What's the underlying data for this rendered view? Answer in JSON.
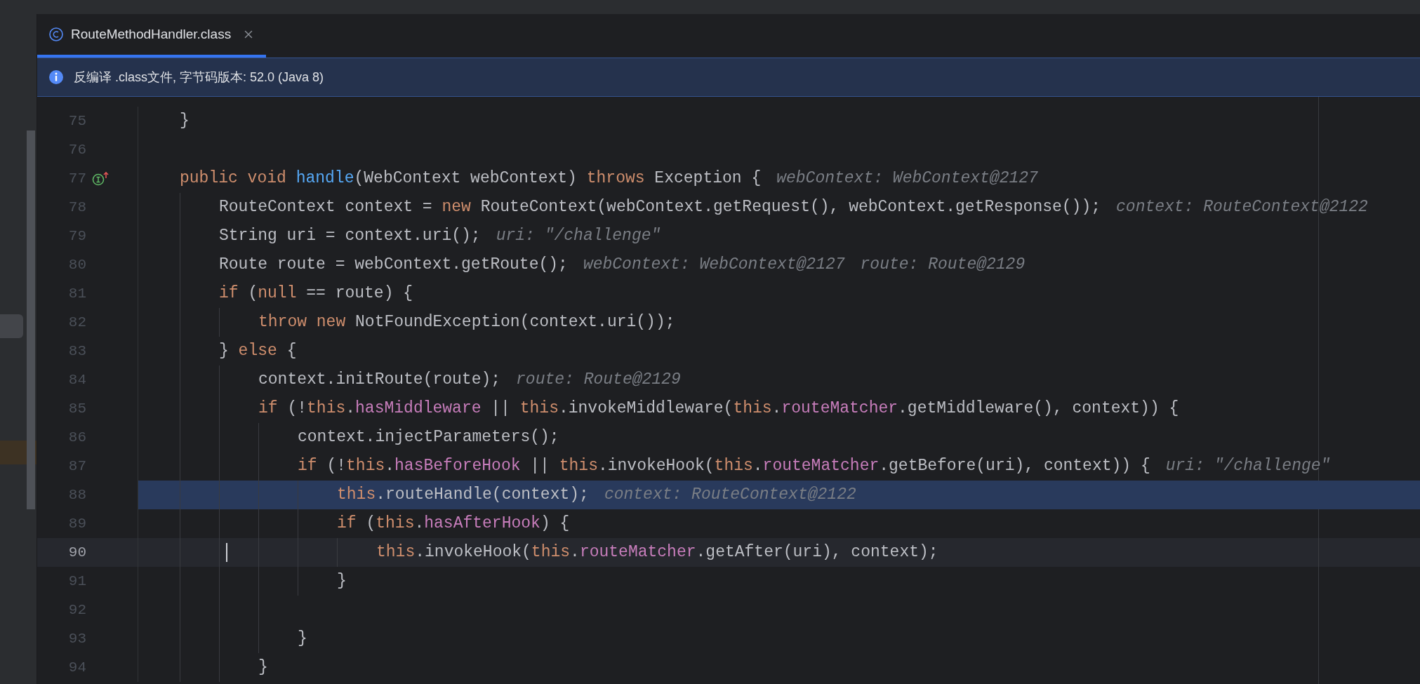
{
  "tab": {
    "title": "RouteMethodHandler.class",
    "selected": true
  },
  "banner": {
    "text": "反编译 .class文件, 字节码版本: 52.0 (Java 8)"
  },
  "lines": [
    {
      "children": [
        {
          "number": "75",
          "highlighted": false,
          "current": false,
          "gutter_marker": false,
          "tokens": [
            {
              "kind": "plain",
              "text": "}"
            }
          ]
        }
      ]
    },
    {
      "number": "76",
      "highlighted": false,
      "current": false,
      "gutter_marker": false
    },
    {
      "children": [
        {
          "number": "77",
          "highlighted": false,
          "current": false,
          "gutter_marker": true,
          "tokens": [
            {
              "kind": "keyword",
              "text": "public void "
            },
            {
              "kind": "method",
              "text": "handle"
            },
            {
              "kind": "plain",
              "text": "(WebContext webContext) "
            },
            {
              "kind": "keyword",
              "text": "throws"
            },
            {
              "kind": "plain",
              "text": " Exception {"
            },
            {
              "kind": "hint",
              "text": "webContext: WebContext@2127"
            }
          ]
        },
        {
          "children": [
            {
              "number": "78",
              "highlighted": false,
              "current": false,
              "gutter_marker": false,
              "tokens": [
                {
                  "kind": "plain",
                  "text": "RouteContext context = "
                },
                {
                  "kind": "keyword",
                  "text": "new"
                },
                {
                  "kind": "plain",
                  "text": " RouteContext(webContext.getRequest(), webContext.getResponse());"
                },
                {
                  "kind": "hint",
                  "text": "context: RouteContext@2122"
                }
              ]
            },
            {
              "number": "79",
              "highlighted": false,
              "current": false,
              "gutter_marker": false,
              "tokens": [
                {
                  "kind": "plain",
                  "text": "String uri = context.uri();"
                },
                {
                  "kind": "hint",
                  "text": "uri: \"/challenge\""
                }
              ]
            },
            {
              "number": "80",
              "highlighted": false,
              "current": false,
              "gutter_marker": false,
              "tokens": [
                {
                  "kind": "plain",
                  "text": "Route route = webContext.getRoute();"
                },
                {
                  "kind": "hint",
                  "text": "webContext: WebContext@2127"
                },
                {
                  "kind": "hint",
                  "text": "route: Route@2129"
                }
              ]
            },
            {
              "number": "81",
              "highlighted": false,
              "current": false,
              "gutter_marker": false,
              "tokens": [
                {
                  "kind": "keyword",
                  "text": "if"
                },
                {
                  "kind": "plain",
                  "text": " ("
                },
                {
                  "kind": "keyword",
                  "text": "null"
                },
                {
                  "kind": "plain",
                  "text": " == route) {"
                }
              ]
            },
            {
              "children": [
                {
                  "number": "82",
                  "highlighted": false,
                  "current": false,
                  "gutter_marker": false,
                  "tokens": [
                    {
                      "kind": "keyword",
                      "text": "throw new"
                    },
                    {
                      "kind": "plain",
                      "text": " NotFoundException(context.uri());"
                    }
                  ]
                }
              ]
            },
            {
              "number": "83",
              "highlighted": false,
              "current": false,
              "gutter_marker": false,
              "tokens": [
                {
                  "kind": "plain",
                  "text": "} "
                },
                {
                  "kind": "keyword",
                  "text": "else"
                },
                {
                  "kind": "plain",
                  "text": " {"
                }
              ]
            },
            {
              "children": [
                {
                  "number": "84",
                  "highlighted": false,
                  "current": false,
                  "gutter_marker": false,
                  "tokens": [
                    {
                      "kind": "plain",
                      "text": "context.initRoute(route);"
                    },
                    {
                      "kind": "hint",
                      "text": "route: Route@2129"
                    }
                  ]
                },
                {
                  "number": "85",
                  "highlighted": false,
                  "current": false,
                  "gutter_marker": false,
                  "tokens": [
                    {
                      "kind": "keyword",
                      "text": "if"
                    },
                    {
                      "kind": "plain",
                      "text": " (!"
                    },
                    {
                      "kind": "keyword",
                      "text": "this"
                    },
                    {
                      "kind": "field",
                      "text": ".hasMiddleware"
                    },
                    {
                      "kind": "plain",
                      "text": " || "
                    },
                    {
                      "kind": "keyword",
                      "text": "this"
                    },
                    {
                      "kind": "plain",
                      "text": ".invokeMiddleware("
                    },
                    {
                      "kind": "keyword",
                      "text": "this"
                    },
                    {
                      "kind": "field",
                      "text": ".routeMatcher"
                    },
                    {
                      "kind": "plain",
                      "text": ".getMiddleware(), context)) {"
                    }
                  ]
                },
                {
                  "children": [
                    {
                      "number": "86",
                      "highlighted": false,
                      "current": false,
                      "gutter_marker": false,
                      "tokens": [
                        {
                          "kind": "plain",
                          "text": "context.injectParameters();"
                        }
                      ]
                    },
                    {
                      "number": "87",
                      "highlighted": false,
                      "current": false,
                      "gutter_marker": false,
                      "tokens": [
                        {
                          "kind": "keyword",
                          "text": "if"
                        },
                        {
                          "kind": "plain",
                          "text": " (!"
                        },
                        {
                          "kind": "keyword",
                          "text": "this"
                        },
                        {
                          "kind": "field",
                          "text": ".hasBeforeHook"
                        },
                        {
                          "kind": "plain",
                          "text": " || "
                        },
                        {
                          "kind": "keyword",
                          "text": "this"
                        },
                        {
                          "kind": "plain",
                          "text": ".invokeHook("
                        },
                        {
                          "kind": "keyword",
                          "text": "this"
                        },
                        {
                          "kind": "field",
                          "text": ".routeMatcher"
                        },
                        {
                          "kind": "plain",
                          "text": ".getBefore(uri), context)) {"
                        },
                        {
                          "kind": "hint",
                          "text": "uri: \"/challenge\""
                        }
                      ]
                    },
                    {
                      "children": [
                        {
                          "number": "88",
                          "highlighted": true,
                          "current": false,
                          "gutter_marker": false,
                          "tokens": [
                            {
                              "kind": "keyword",
                              "text": "this"
                            },
                            {
                              "kind": "plain",
                              "text": ".routeHandle(context);"
                            },
                            {
                              "kind": "hint",
                              "text": "context: RouteContext@2122"
                            }
                          ]
                        },
                        {
                          "number": "89",
                          "highlighted": false,
                          "current": false,
                          "gutter_marker": false,
                          "tokens": [
                            {
                              "kind": "keyword",
                              "text": "if"
                            },
                            {
                              "kind": "plain",
                              "text": " ("
                            },
                            {
                              "kind": "keyword",
                              "text": "this"
                            },
                            {
                              "kind": "field",
                              "text": ".hasAfterHook"
                            },
                            {
                              "kind": "plain",
                              "text": ") {"
                            }
                          ]
                        },
                        {
                          "children": [
                            {
                              "number": "90",
                              "highlighted": false,
                              "current": true,
                              "gutter_marker": false,
                              "tokens": [
                                {
                                  "kind": "keyword",
                                  "text": "this"
                                },
                                {
                                  "kind": "plain",
                                  "text": ".invokeHook("
                                },
                                {
                                  "kind": "keyword",
                                  "text": "this"
                                },
                                {
                                  "kind": "field",
                                  "text": ".routeMatcher"
                                },
                                {
                                  "kind": "plain",
                                  "text": ".getAfter(uri), context);"
                                }
                              ]
                            }
                          ]
                        },
                        {
                          "number": "91",
                          "highlighted": false,
                          "current": false,
                          "gutter_marker": false,
                          "tokens": [
                            {
                              "kind": "plain",
                              "text": "}"
                            }
                          ]
                        }
                      ]
                    },
                    {
                      "number": "92",
                      "highlighted": false,
                      "current": false,
                      "gutter_marker": false
                    },
                    {
                      "number": "93",
                      "highlighted": false,
                      "current": false,
                      "gutter_marker": false,
                      "tokens": [
                        {
                          "kind": "plain",
                          "text": "}"
                        }
                      ]
                    }
                  ]
                },
                {
                  "number": "94",
                  "highlighted": false,
                  "current": false,
                  "gutter_marker": false,
                  "tokens": [
                    {
                      "kind": "plain",
                      "text": "}"
                    }
                  ]
                }
              ]
            }
          ]
        }
      ]
    }
  ]
}
